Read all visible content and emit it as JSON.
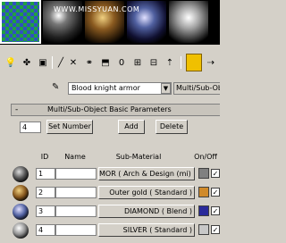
{
  "watermark": "WWW.MISSYUAN.COM",
  "material_name": "Blood knight armor",
  "material_type": "Multi/Sub-Object",
  "rollout": {
    "toggle": "-",
    "title": "Multi/Sub-Object Basic Parameters"
  },
  "set_number": {
    "value": "4",
    "button": "Set Number",
    "add": "Add",
    "delete": "Delete"
  },
  "columns": {
    "id": "ID",
    "name": "Name",
    "sub_material": "Sub-Material",
    "onoff": "On/Off"
  },
  "rows": [
    {
      "id": "1",
      "name": "",
      "sub": "MOR  ( Arch & Design (mi) )",
      "swatch": "#808080",
      "checked": true
    },
    {
      "id": "2",
      "name": "",
      "sub": "Outer gold  ( Standard )",
      "swatch": "#d08a2a",
      "checked": true
    },
    {
      "id": "3",
      "name": "",
      "sub": "DIAMOND  ( Blend )",
      "swatch": "#2a2a9a",
      "checked": true
    },
    {
      "id": "4",
      "name": "",
      "sub": "SILVER  ( Standard )",
      "swatch": "#c8c8c8",
      "checked": true
    }
  ],
  "colors": {
    "panel": "#d4d0c8",
    "toolbar_toggle": "#f0c000"
  }
}
